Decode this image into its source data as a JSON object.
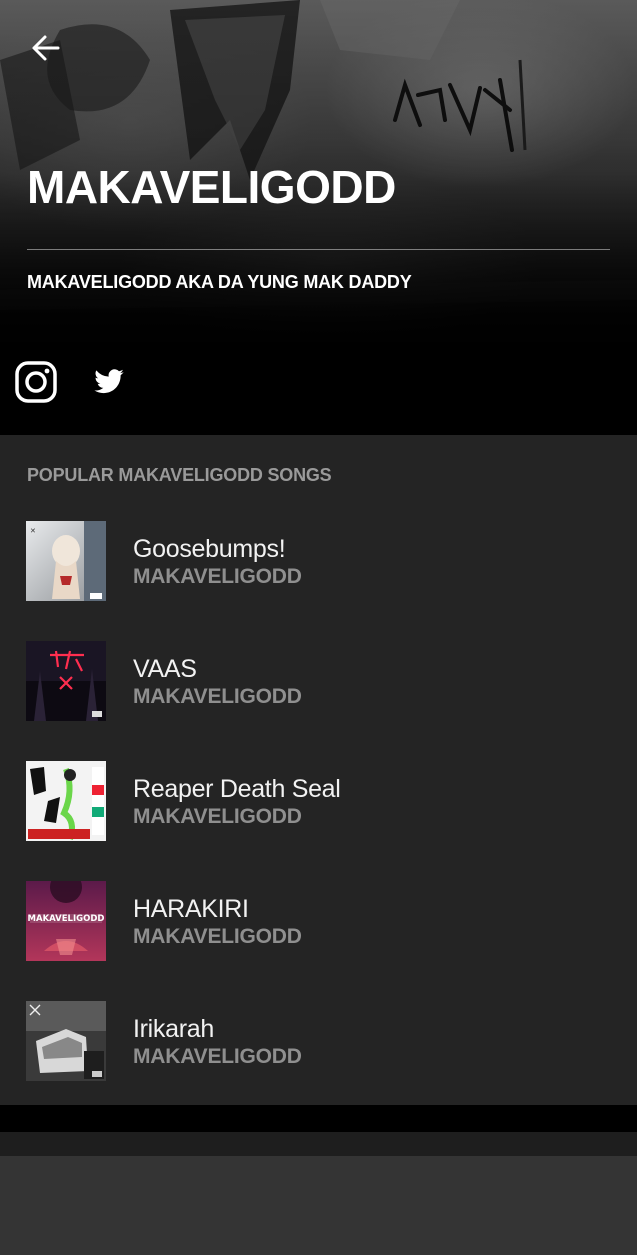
{
  "header": {
    "back_icon": "arrow-left-icon",
    "artist_name": "MAKAVELIGODD",
    "bio": "MAKAVELIGODD AKA DA YUNG MAK DADDY",
    "socials": [
      {
        "name": "instagram",
        "icon": "instagram-icon"
      },
      {
        "name": "twitter",
        "icon": "twitter-icon"
      }
    ]
  },
  "songs_section": {
    "heading": "POPULAR MAKAVELIGODD SONGS",
    "songs": [
      {
        "title": "Goosebumps!",
        "artist": "MAKAVELIGODD"
      },
      {
        "title": "VAAS",
        "artist": "MAKAVELIGODD"
      },
      {
        "title": "Reaper Death Seal",
        "artist": "MAKAVELIGODD"
      },
      {
        "title": "HARAKIRI",
        "artist": "MAKAVELIGODD"
      },
      {
        "title": "Irikarah",
        "artist": "MAKAVELIGODD"
      }
    ]
  },
  "colors": {
    "header_bg": "#000000",
    "list_bg": "#242424",
    "title_text": "#f2f2f2",
    "subtitle_text": "#8f8f8f",
    "heading_text": "#9a9a9a"
  }
}
